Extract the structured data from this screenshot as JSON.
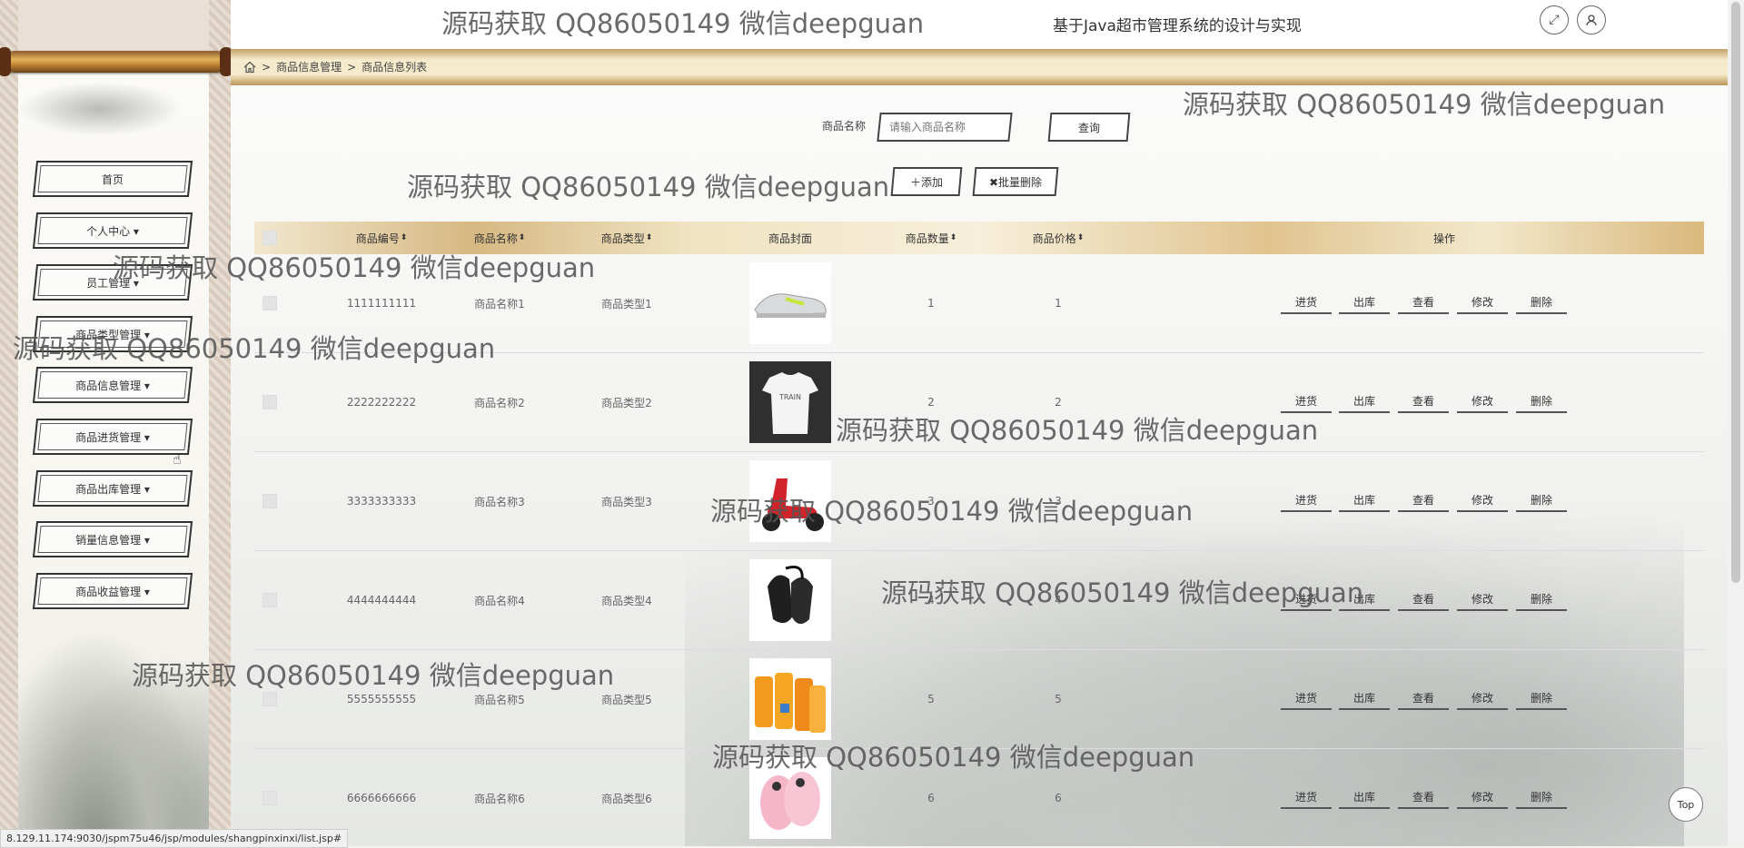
{
  "app": {
    "title": "基于Java的超市管理系统的设计与实现",
    "title_partial": "基于Java超市管理系统的设计与实现"
  },
  "header": {
    "fullscreen_icon": "expand-icon",
    "user_icon": "user-icon"
  },
  "breadcrumb": {
    "home_icon": "home-icon",
    "sep": ">",
    "level1": "商品信息管理",
    "level2": "商品信息列表"
  },
  "sidebar": {
    "items": [
      {
        "label": "首页"
      },
      {
        "label": "个人中心 ▾"
      },
      {
        "label": "员工管理 ▾"
      },
      {
        "label": "商品类型管理 ▾"
      },
      {
        "label": "商品信息管理 ▾"
      },
      {
        "label": "商品进货管理 ▾"
      },
      {
        "label": "商品出库管理 ▾"
      },
      {
        "label": "销量信息管理 ▾"
      },
      {
        "label": "商品收益管理 ▾"
      }
    ]
  },
  "search": {
    "label": "商品名称",
    "placeholder": "请输入商品名称",
    "button": "查询"
  },
  "toolbar": {
    "add": "＋添加",
    "batch_delete": "✖批量删除"
  },
  "table": {
    "columns": [
      "商品编号",
      "商品名称",
      "商品类型",
      "商品封面",
      "商品数量",
      "商品价格",
      "操作"
    ],
    "sort_indicator": "⬍",
    "actions": [
      "进货",
      "出库",
      "查看",
      "修改",
      "删除"
    ],
    "rows": [
      {
        "id": "1111111111",
        "name": "商品名称1",
        "type": "商品类型1",
        "cover": "sneaker-image",
        "qty": "1",
        "price": "1"
      },
      {
        "id": "2222222222",
        "name": "商品名称2",
        "type": "商品类型2",
        "cover": "tshirt-image",
        "qty": "2",
        "price": "2"
      },
      {
        "id": "3333333333",
        "name": "商品名称3",
        "type": "商品类型3",
        "cover": "scooter-image",
        "qty": "3",
        "price": "3"
      },
      {
        "id": "4444444444",
        "name": "商品名称4",
        "type": "商品类型4",
        "cover": "gloves-image",
        "qty": "4",
        "price": "4"
      },
      {
        "id": "5555555555",
        "name": "商品名称5",
        "type": "商品类型5",
        "cover": "juice-image",
        "qty": "5",
        "price": "5"
      },
      {
        "id": "6666666666",
        "name": "商品名称6",
        "type": "商品类型6",
        "cover": "slippers-image",
        "qty": "6",
        "price": "6"
      }
    ]
  },
  "watermark": "源码获取 QQ86050149 微信deepguan",
  "status_url": "8.129.11.174:9030/jspm75u46/jsp/modules/shangpinxinxi/list.jsp#",
  "back_to_top": "Top",
  "colors": {
    "accent_gold": "#d6b882",
    "frame": "#444444"
  }
}
